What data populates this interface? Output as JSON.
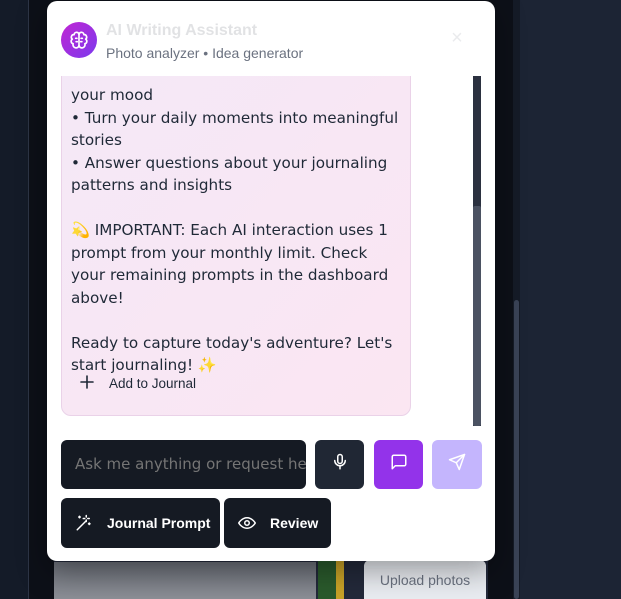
{
  "background": {
    "upload_label": "Upload photos"
  },
  "assistant": {
    "title": "AI Writing Assistant",
    "subtitle": "Photo analyzer • Idea generator",
    "close_label": "×"
  },
  "message": {
    "lines": [
      "your mood",
      "• Turn your daily moments into meaningful stories",
      "• Answer questions about your journaling patterns and insights",
      "",
      "💫 IMPORTANT: Each AI interaction uses 1 prompt from your monthly limit. Check your remaining prompts in the dashboard above!",
      "",
      "Ready to capture today's adventure? Let's start journaling! ✨"
    ],
    "add_to_journal": "Add to Journal"
  },
  "input": {
    "placeholder": "Ask me anything or request help..."
  },
  "actions": {
    "journal_prompt": "Journal Prompt",
    "review": "Review"
  },
  "colors": {
    "accent_purple": "#9333ea",
    "send_disabled": "#c4b5fd",
    "bubble_pink": "#fbe6f2",
    "dark_button": "#151a23"
  },
  "icons": {
    "avatar": "brain-icon",
    "add": "plus-icon",
    "mic": "microphone-icon",
    "chat": "message-square-icon",
    "send": "send-icon",
    "prompt": "magic-wand-icon",
    "review": "eye-icon"
  }
}
